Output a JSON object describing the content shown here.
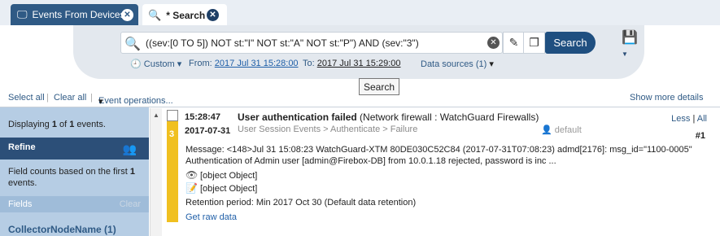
{
  "tabs": [
    {
      "label": "Events From Devices",
      "active": false
    },
    {
      "label": "* Search",
      "active": true
    }
  ],
  "search": {
    "query": "((sev:[0 TO 5]) NOT st:\"I\" NOT st:\"A\" NOT st:\"P\") AND (sev:\"3\")",
    "button_label": "Search",
    "tooltip": "Search"
  },
  "range": {
    "mode_label": "Custom",
    "from_label": "From:",
    "from_value": "2017 Jul 31 15:28:00",
    "to_label": "To:",
    "to_value": "2017 Jul 31 15:29:00",
    "sources_label": "Data sources (1)"
  },
  "toolbar": {
    "select_all": "Select all",
    "clear_all": "Clear all",
    "event_ops": "Event operations...",
    "show_more": "Show more details"
  },
  "sidebar": {
    "display_pre": "Displaying ",
    "display_n": "1",
    "display_mid": " of ",
    "display_total": "1",
    "display_post": " events.",
    "refine_label": "Refine",
    "field_counts_pre": "Field counts based on the first ",
    "field_counts_n": "1",
    "field_counts_post": " events.",
    "fields_label": "Fields",
    "clear_label": "Clear",
    "collector_field": "CollectorNodeName (1)"
  },
  "event": {
    "time": "15:28:47",
    "date": "2017-07-31",
    "severity": "3",
    "title": "User authentication failed",
    "source": "(Network firewall : WatchGuard Firewalls)",
    "category": "User Session Events > Authenticate > Failure",
    "default_label": "default",
    "less_label": "Less",
    "all_label": "All",
    "number": "#1",
    "message_line1": "Message: <148>Jul 31 15:08:23 WatchGuard-XTM 80DE030C52C84 (2017-07-31T07:08:23) admd[2176]: msg_id=\"1100-0005\"",
    "message_line2": "Authentication of Admin user [admin@Firebox-DB] from 10.0.1.18 rejected, password is inc ...",
    "obj1": "[object Object]",
    "obj2": "[object Object]",
    "retention": "Retention period: Min 2017 Oct 30 (Default data retention)",
    "raw_link": "Get raw data"
  },
  "colors": {
    "tab_active_bg": "#2f5a85",
    "refine_bg": "#2c4f78",
    "sidebar_bg": "#b6cde4",
    "severity_3": "#f0c020",
    "link": "#1f5fa8"
  }
}
